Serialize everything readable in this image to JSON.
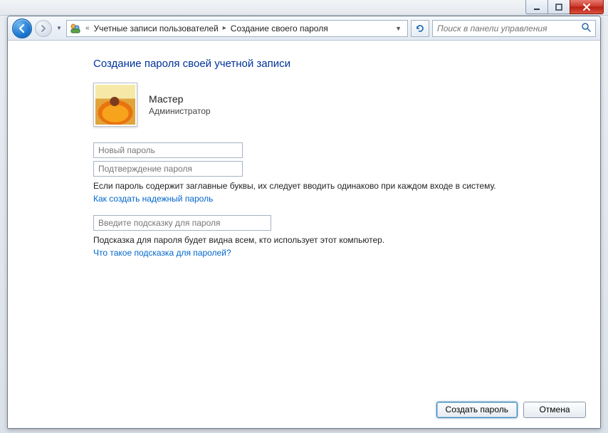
{
  "breadcrumbs": {
    "item1": "Учетные записи пользователей",
    "item2": "Создание своего пароля"
  },
  "search": {
    "placeholder": "Поиск в панели управления"
  },
  "page": {
    "title": "Создание пароля своей учетной записи"
  },
  "user": {
    "name": "Мастер",
    "role": "Администратор"
  },
  "fields": {
    "new_password_placeholder": "Новый пароль",
    "confirm_password_placeholder": "Подтверждение пароля",
    "hint_placeholder": "Введите подсказку для пароля"
  },
  "text": {
    "caps_warning": "Если пароль содержит заглавные буквы, их следует вводить одинаково при каждом входе в систему.",
    "strong_pw_link": "Как создать надежный пароль",
    "hint_warning": "Подсказка для пароля будет видна всем, кто использует этот компьютер.",
    "hint_link": "Что такое подсказка для паролей?"
  },
  "buttons": {
    "create": "Создать пароль",
    "cancel": "Отмена"
  }
}
